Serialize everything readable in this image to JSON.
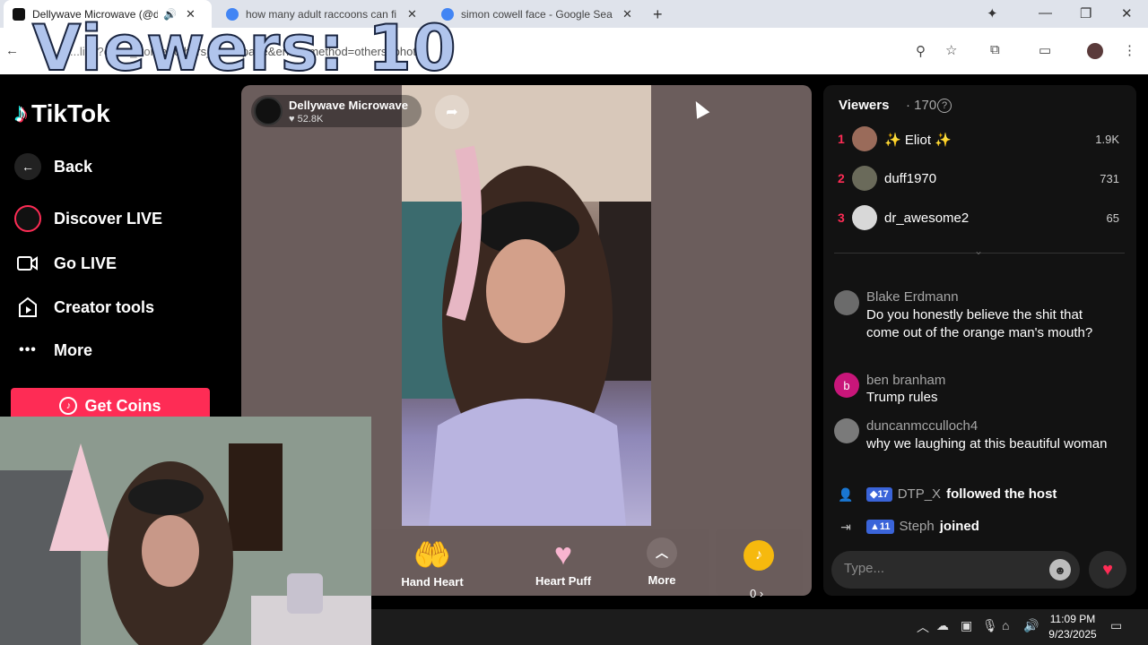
{
  "browser": {
    "tabs": [
      {
        "title": "Dellywave Microwave (@de",
        "active": true
      },
      {
        "title": "how many adult raccoons can fi",
        "active": false
      },
      {
        "title": "simon cowell face - Google Sea",
        "active": false
      }
    ],
    "url": "rge=others_homepage&enter_method=others_photo",
    "url_prefix": "...live?enter_fro"
  },
  "overlay": {
    "viewers_text": "Viewers: 10"
  },
  "sidebar": {
    "logo_text": "TikTok",
    "items": [
      {
        "label": "Back",
        "icon": "back-arrow-icon"
      },
      {
        "label": "Discover LIVE",
        "icon": "live-avatar-icon"
      },
      {
        "label": "Go LIVE",
        "icon": "video-camera-icon"
      },
      {
        "label": "Creator tools",
        "icon": "creator-tools-icon"
      },
      {
        "label": "More",
        "icon": "more-dots-icon"
      }
    ],
    "coins_button": "Get Coins"
  },
  "stream": {
    "host_name": "Dellywave Microwave",
    "host_likes": "52.8K",
    "gifts": [
      {
        "label": "Hand Heart",
        "icon": "hand-heart-icon"
      },
      {
        "label": "Heart Puff",
        "icon": "heart-puff-icon"
      }
    ],
    "more_label": "More",
    "coins": "0"
  },
  "viewers_panel": {
    "title": "Viewers",
    "count": "170",
    "top": [
      {
        "rank": "1",
        "name": "✨ Eliot ✨",
        "score": "1.9K",
        "color": "#9a6b5a"
      },
      {
        "rank": "2",
        "name": "duff1970",
        "score": "731",
        "color": "#6a6a5a"
      },
      {
        "rank": "3",
        "name": "dr_awesome2",
        "score": "65",
        "color": "#d8d8d8"
      }
    ]
  },
  "chat": {
    "messages": [
      {
        "user": "Blake Erdmann",
        "text": "Do you honestly believe the shit that come out of the orange man's mouth?"
      },
      {
        "user": "ben branham",
        "text": "Trump rules",
        "initial": "b"
      },
      {
        "user": "duncanmcculloch4",
        "text": "why we laughing at this beautiful woman"
      }
    ],
    "events": [
      {
        "level": "17",
        "user": "DTP_X",
        "action": "followed the host"
      },
      {
        "level": "11",
        "user": "Steph",
        "action": "joined"
      }
    ],
    "input_placeholder": "Type..."
  },
  "taskbar": {
    "time": "11:09 PM",
    "date": "9/23/2025"
  },
  "colors": {
    "accent": "#fe2c55",
    "panel": "#121212",
    "stream_bg": "#6b5d5c"
  }
}
